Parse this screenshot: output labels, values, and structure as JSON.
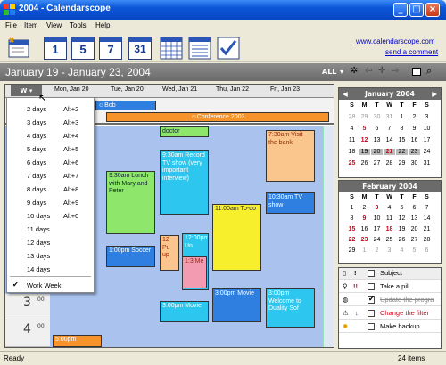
{
  "window": {
    "title": "2004 - Calendarscope"
  },
  "menu": [
    "File",
    "Item",
    "View",
    "Tools",
    "Help"
  ],
  "toolbar": {
    "cal_buttons": [
      "1",
      "5",
      "7",
      "31"
    ],
    "link_site": "www.calendarscope.com",
    "link_comment": "send a comment"
  },
  "datebar": {
    "range": "January 19 - January 23, 2004",
    "filter": "ALL"
  },
  "calendar": {
    "view_button": "W",
    "days": [
      "Mon, Jan 20",
      "Tue, Jan 20",
      "Wed, Jan 21",
      "Thu, Jan 22",
      "Fri, Jan 23"
    ],
    "allday": [
      {
        "text": "Bob"
      },
      {
        "text": "Conference 2003"
      }
    ],
    "hours": [
      "3",
      "4"
    ],
    "hour_suffix": "00",
    "events": [
      {
        "text": "doctor"
      },
      {
        "text": "7:30am Visit the bank"
      },
      {
        "text": "9:30am Record TV show (very important interview)"
      },
      {
        "text": "9:30am Lunch with Mary and Peter"
      },
      {
        "text": "10:30am TV show"
      },
      {
        "text": "11:00am To-do"
      },
      {
        "text": "12 Pu up"
      },
      {
        "text": "1:00pm Soccer"
      },
      {
        "text": "12:00pm Un"
      },
      {
        "text": "1:3 Me"
      },
      {
        "text": "3:00pm Movie"
      },
      {
        "text": "3:00pm Movie"
      },
      {
        "text": "3:00pm Welcome to Duality Sof"
      },
      {
        "text": "5:00pm"
      }
    ]
  },
  "view_menu": {
    "items": [
      {
        "label": "2 days",
        "key": "Alt+2"
      },
      {
        "label": "3 days",
        "key": "Alt+3"
      },
      {
        "label": "4 days",
        "key": "Alt+4"
      },
      {
        "label": "5 days",
        "key": "Alt+5"
      },
      {
        "label": "6 days",
        "key": "Alt+6"
      },
      {
        "label": "7 days",
        "key": "Alt+7"
      },
      {
        "label": "8 days",
        "key": "Alt+8"
      },
      {
        "label": "9 days",
        "key": "Alt+9"
      },
      {
        "label": "10 days",
        "key": "Alt+0"
      },
      {
        "label": "11 days",
        "key": ""
      },
      {
        "label": "12 days",
        "key": ""
      },
      {
        "label": "13 days",
        "key": ""
      },
      {
        "label": "14 days",
        "key": ""
      }
    ],
    "work_week": "Work Week"
  },
  "jan": {
    "title": "January 2004",
    "dow": [
      "S",
      "M",
      "T",
      "W",
      "T",
      "F",
      "S"
    ],
    "weeks": [
      [
        "28",
        "29",
        "30",
        "31",
        "1",
        "2",
        "3"
      ],
      [
        "4",
        "5",
        "6",
        "7",
        "8",
        "9",
        "10"
      ],
      [
        "11",
        "12",
        "13",
        "14",
        "15",
        "16",
        "17"
      ],
      [
        "18",
        "19",
        "20",
        "21",
        "22",
        "23",
        "24"
      ],
      [
        "25",
        "26",
        "27",
        "28",
        "29",
        "30",
        "31"
      ]
    ]
  },
  "feb": {
    "title": "February 2004",
    "dow": [
      "S",
      "M",
      "T",
      "W",
      "T",
      "F",
      "S"
    ],
    "weeks": [
      [
        "1",
        "2",
        "3",
        "4",
        "5",
        "6",
        "7"
      ],
      [
        "8",
        "9",
        "10",
        "11",
        "12",
        "13",
        "14"
      ],
      [
        "15",
        "16",
        "17",
        "18",
        "19",
        "20",
        "21"
      ],
      [
        "22",
        "23",
        "24",
        "25",
        "26",
        "27",
        "28"
      ],
      [
        "29",
        "1",
        "2",
        "3",
        "4",
        "5",
        "6"
      ]
    ]
  },
  "tasks": {
    "header": "Subject",
    "items": [
      {
        "text": "Take a pill",
        "done": false
      },
      {
        "text": "Update the progra",
        "done": true
      },
      {
        "text": "Change the filter",
        "done": false
      },
      {
        "text": "Make backup",
        "done": false
      }
    ]
  },
  "status": {
    "left": "Ready",
    "right": "24 items"
  },
  "colors": {
    "titlebar": "#0a56d8",
    "accent_red": "#d8001a",
    "grid_blue": "#a9c3ee"
  }
}
